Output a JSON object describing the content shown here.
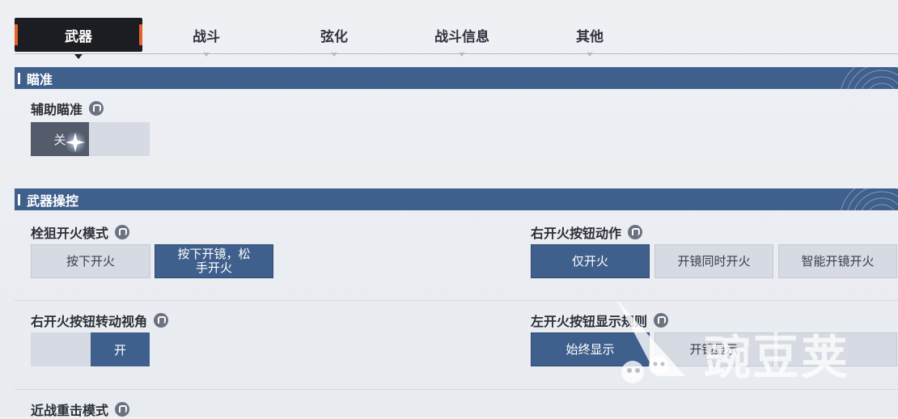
{
  "tabs": [
    {
      "label": "武器",
      "active": true
    },
    {
      "label": "战斗",
      "active": false
    },
    {
      "label": "弦化",
      "active": false
    },
    {
      "label": "战斗信息",
      "active": false
    },
    {
      "label": "其他",
      "active": false
    }
  ],
  "sections": {
    "aim": {
      "title": "瞄准",
      "assist_aim": {
        "label": "辅助瞄准",
        "state_label": "关"
      }
    },
    "weapon_control": {
      "title": "武器操控",
      "sniper_fire_mode": {
        "label": "栓狙开火模式",
        "options": [
          "按下开火",
          "按下开镜，松手开火"
        ],
        "selected": 1
      },
      "right_fire_action": {
        "label": "右开火按钮动作",
        "options": [
          "仅开火",
          "开镜同时开火",
          "智能开镜开火"
        ],
        "selected": 0
      },
      "right_fire_rotate": {
        "label": "右开火按钮转动视角",
        "on_label": "开"
      },
      "left_fire_display": {
        "label": "左开火按钮显示规则",
        "options": [
          "始终显示",
          "开镜显示"
        ],
        "selected": 0
      },
      "melee_mode": {
        "label": "近战重击模式"
      }
    }
  },
  "watermark": {
    "text": "豌豆荚"
  },
  "colors": {
    "accent": "#3f5f8c",
    "tab_active": "#1c1d22",
    "tab_edge": "#e8602a"
  }
}
